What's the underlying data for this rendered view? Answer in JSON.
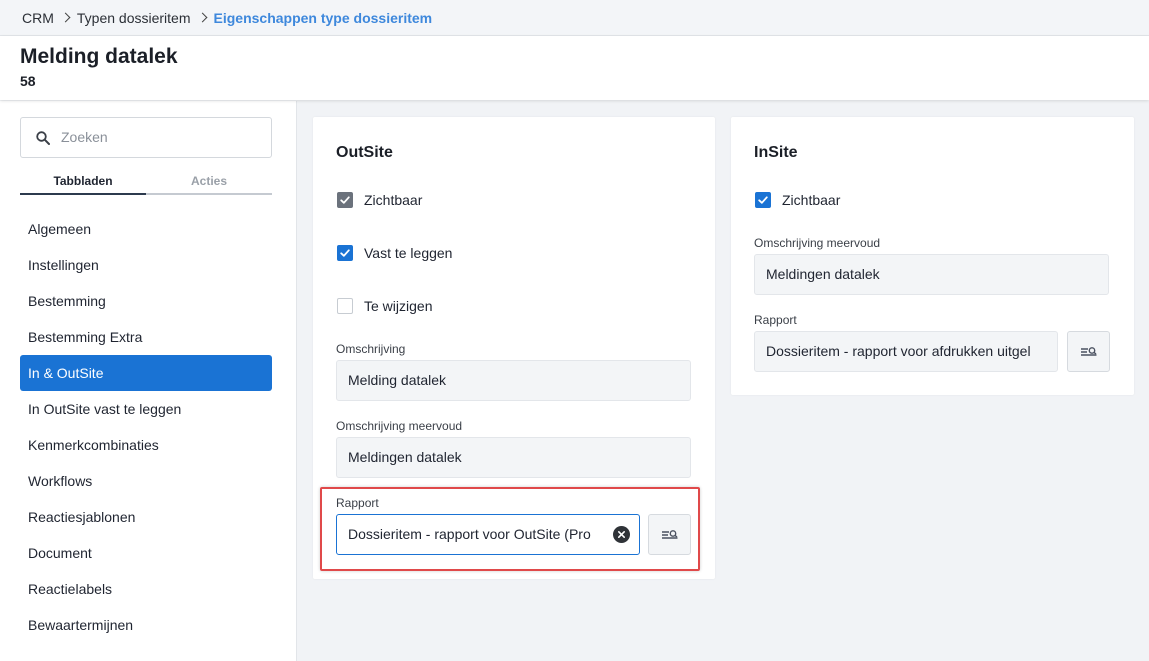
{
  "breadcrumb": {
    "items": [
      "CRM",
      "Typen dossieritem",
      "Eigenschappen type dossieritem"
    ]
  },
  "header": {
    "title": "Melding datalek",
    "subtitle": "58"
  },
  "sidebar": {
    "search_placeholder": "Zoeken",
    "tabs": [
      "Tabbladen",
      "Acties"
    ],
    "items": [
      {
        "label": "Algemeen"
      },
      {
        "label": "Instellingen"
      },
      {
        "label": "Bestemming"
      },
      {
        "label": "Bestemming Extra"
      },
      {
        "label": "In & OutSite",
        "active": true
      },
      {
        "label": "In OutSite vast te leggen"
      },
      {
        "label": "Kenmerkcombinaties"
      },
      {
        "label": "Workflows"
      },
      {
        "label": "Reactiesjablonen"
      },
      {
        "label": "Document"
      },
      {
        "label": "Reactielabels"
      },
      {
        "label": "Bewaartermijnen"
      }
    ]
  },
  "outsite": {
    "title": "OutSite",
    "checkboxes": [
      {
        "label": "Zichtbaar",
        "checked": true
      },
      {
        "label": "Vast te leggen",
        "checked": true
      },
      {
        "label": "Te wijzigen",
        "checked": false
      }
    ],
    "omschrijving_label": "Omschrijving",
    "omschrijving_value": "Melding datalek",
    "meervoud_label": "Omschrijving meervoud",
    "meervoud_value": "Meldingen datalek",
    "rapport_label": "Rapport",
    "rapport_value": "Dossieritem - rapport voor OutSite (Pro"
  },
  "insite": {
    "title": "InSite",
    "checkbox_label": "Zichtbaar",
    "meervoud_label": "Omschrijving meervoud",
    "meervoud_value": "Meldingen datalek",
    "rapport_label": "Rapport",
    "rapport_value": "Dossieritem - rapport voor afdrukken uitgel"
  },
  "colors": {
    "accent": "#1a73d4",
    "breadcrumb_active": "#3e88dc",
    "highlight": "#e0494a"
  }
}
